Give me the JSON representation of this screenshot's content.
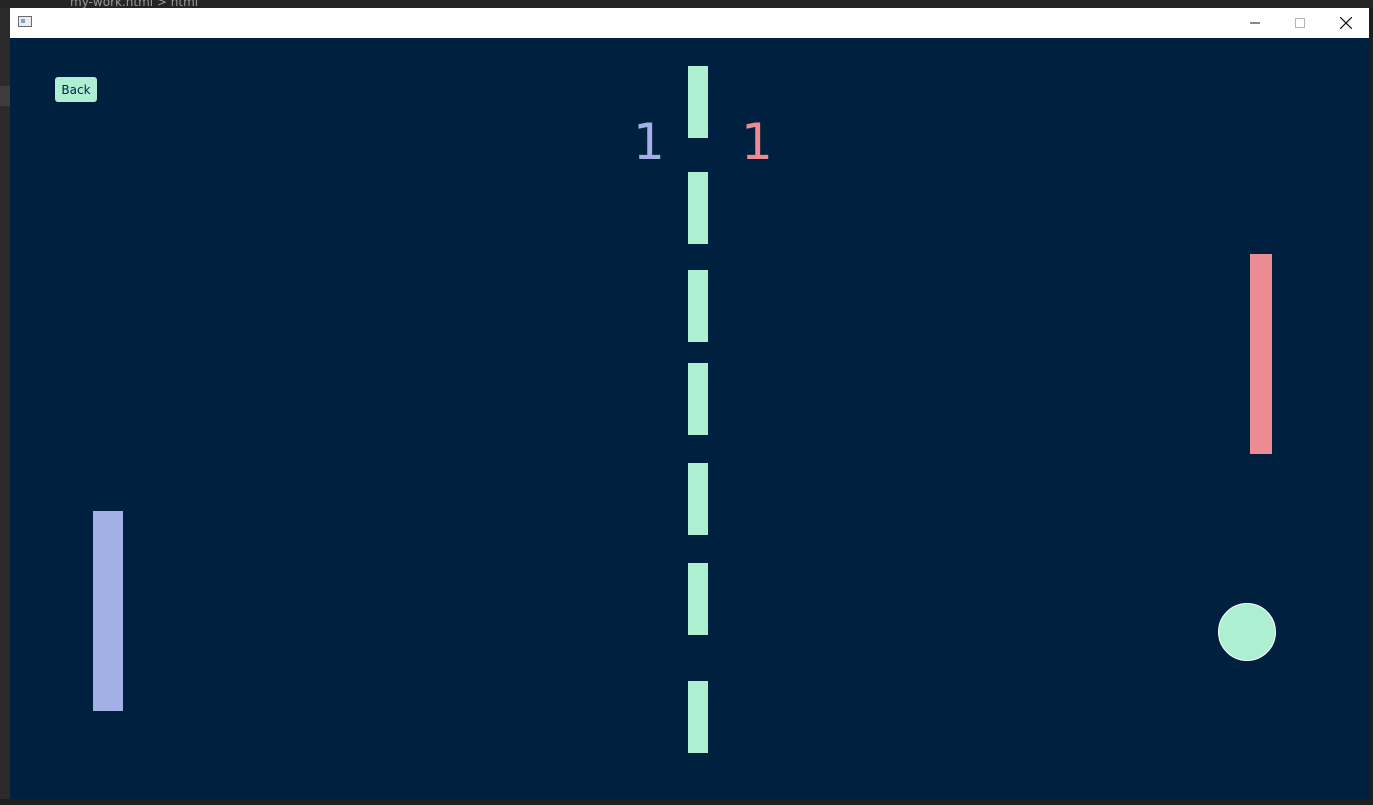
{
  "background_editor": {
    "tab_text": "my-work.html > html"
  },
  "window": {
    "icon": "app-window-icon",
    "controls": {
      "minimize_icon": "minimize-icon",
      "maximize_icon": "maximize-icon",
      "close_icon": "close-icon"
    }
  },
  "game": {
    "back_label": "Back",
    "score_left": "1",
    "score_right": "1",
    "colors": {
      "background": "#00203f",
      "accent": "#adefd1",
      "left_player": "#a3b0e6",
      "right_player": "#ec8b91"
    },
    "net_dash_count": 7
  }
}
